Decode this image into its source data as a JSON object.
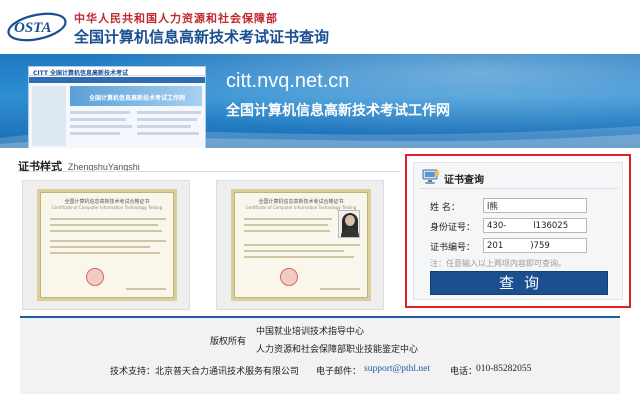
{
  "header": {
    "logo_text": "OSTA",
    "org_name": "中华人民共和国人力资源和社会保障部",
    "site_title": "全国计算机信息高新技术考试证书查询"
  },
  "banner": {
    "thumb_logo": "CITT 全国计算机信息高新技术考试",
    "thumb_caption": "全国计算机信息高新技术考试工作网",
    "url": "citt.nvq.net.cn",
    "subtitle": "全国计算机信息高新技术考试工作网"
  },
  "samples": {
    "title": "证书样式",
    "subtitle": "ZhengshuYangshi",
    "certificates": [
      {
        "title": "全国计算机信息高新技术考试合格证书",
        "subtitle": "Certificate of Computer Information Technology Testing"
      },
      {
        "title": "全国计算机信息高新技术考试合格证书",
        "subtitle": "Certificate of Computer Information Technology Testing"
      }
    ]
  },
  "query": {
    "title": "证书查询",
    "fields": [
      {
        "label": "姓    名：",
        "value": "l熊"
      },
      {
        "label": "身份证号：",
        "value": "430-          l136025"
      },
      {
        "label": "证书编号：",
        "value": "201          )759"
      }
    ],
    "note": "注：任意输入以上两项内容即可查询。",
    "button_label": "查询"
  },
  "footer": {
    "copyright_label": "版权所有",
    "org_line_1": "中国就业培训技术指导中心",
    "org_line_2": "人力资源和社会保障部职业技能鉴定中心",
    "support": "技术支持：北京普天合力通讯技术服务有限公司",
    "email_label": "电子邮件：",
    "email": "support@pthl.net",
    "phone_label": "电话：",
    "phone": "010-85282055"
  },
  "colors": {
    "brand_blue": "#1b4f8e",
    "brand_red": "#c0282d",
    "highlight_red": "#e0202a"
  }
}
